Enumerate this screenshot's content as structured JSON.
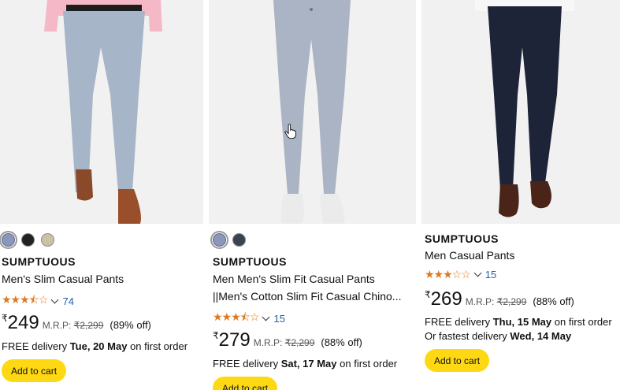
{
  "products": [
    {
      "brand": "SUMPTUOUS",
      "title": "Men's Slim Casual Pants",
      "title_line2": "",
      "rating_stars": "★★★⯪☆",
      "rating_count": "74",
      "currency": "₹",
      "price": "249",
      "mrp_label": "M.R.P:",
      "mrp": "₹2,299",
      "discount": "(89% off)",
      "delivery_prefix": "FREE delivery",
      "delivery_date": "Tue, 20 May",
      "delivery_suffix": "on first order",
      "fastest_prefix": "",
      "fastest_date": "",
      "add_to_cart": "Add to cart",
      "swatch_colors": [
        "#8a97b8",
        "#222222",
        "#c9c2a8"
      ],
      "pant_color": "#a7b5c9"
    },
    {
      "brand": "SUMPTUOUS",
      "title": "Men Men's Slim Fit Casual Pants",
      "title_line2": "||Men's Cotton Slim Fit Casual Chino...",
      "rating_stars": "★★★⯪☆",
      "rating_count": "15",
      "currency": "₹",
      "price": "279",
      "mrp_label": "M.R.P:",
      "mrp": "₹2,299",
      "discount": "(88% off)",
      "delivery_prefix": "FREE delivery",
      "delivery_date": "Sat, 17 May",
      "delivery_suffix": "on first order",
      "fastest_prefix": "",
      "fastest_date": "",
      "add_to_cart": "Add to cart",
      "swatch_colors": [
        "#8a97b8",
        "#3a4450"
      ],
      "pant_color": "#aab4c4"
    },
    {
      "brand": "SUMPTUOUS",
      "title": "Men Casual Pants",
      "title_line2": "",
      "rating_stars": "★★★☆☆",
      "rating_count": "15",
      "currency": "₹",
      "price": "269",
      "mrp_label": "M.R.P:",
      "mrp": "₹2,299",
      "discount": "(88% off)",
      "delivery_prefix": "FREE delivery",
      "delivery_date": "Thu, 15 May",
      "delivery_suffix": "on first order",
      "fastest_prefix": "Or fastest delivery",
      "fastest_date": "Wed, 14 May",
      "add_to_cart": "Add to cart",
      "swatch_colors": [],
      "pant_color": "#1d2438"
    }
  ],
  "colors": {
    "star": "#de7921",
    "link": "#2162a1",
    "cart_button": "#ffd814"
  }
}
